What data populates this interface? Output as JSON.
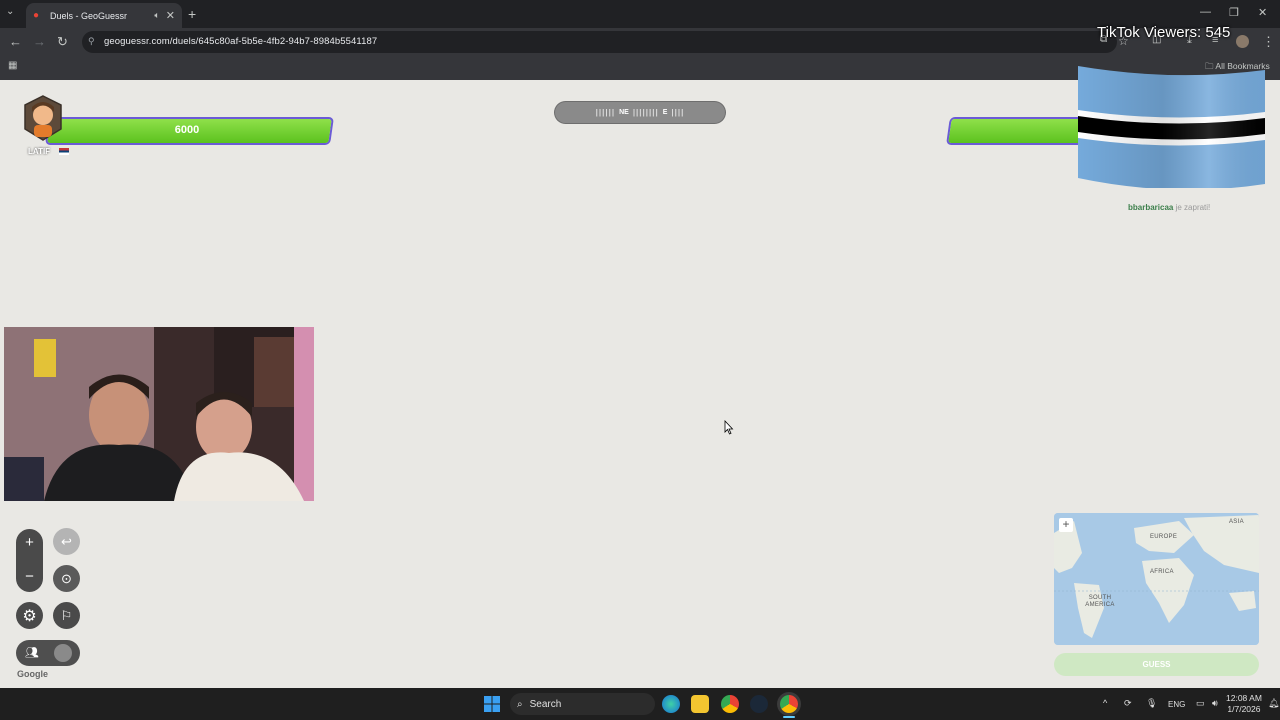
{
  "browser": {
    "tab_title": "Duels - GeoGuessr",
    "url": "geoguessr.com/duels/645c80af-5b5e-4fb2-94b7-8984b5541187",
    "bookmarks_label": "All Bookmarks"
  },
  "overlay": {
    "tiktok_viewers": "TikTok Viewers: 545",
    "donor_name": "bbarbaricaa",
    "donor_text": "je zaprati!"
  },
  "game": {
    "player_left": {
      "health": "6000",
      "name": "LATIF",
      "health_fraction": 1.0
    },
    "player_right": {
      "health_fraction": 1.0
    },
    "compass": {
      "label_1": "NE",
      "label_2": "E"
    },
    "guess_label": "GUESS",
    "google_label": "Google",
    "map_labels": [
      "EUROPE",
      "ASIA",
      "AFRICA",
      "SOUTH AMERICA"
    ]
  },
  "taskbar": {
    "search_label": "Search",
    "lang": "ENG",
    "time": "12:08 AM",
    "date": "1/7/2026"
  },
  "colors": {
    "health": "#7ed53a",
    "health_border": "#6b5bd6",
    "page_bg": "#e9e8e4"
  }
}
